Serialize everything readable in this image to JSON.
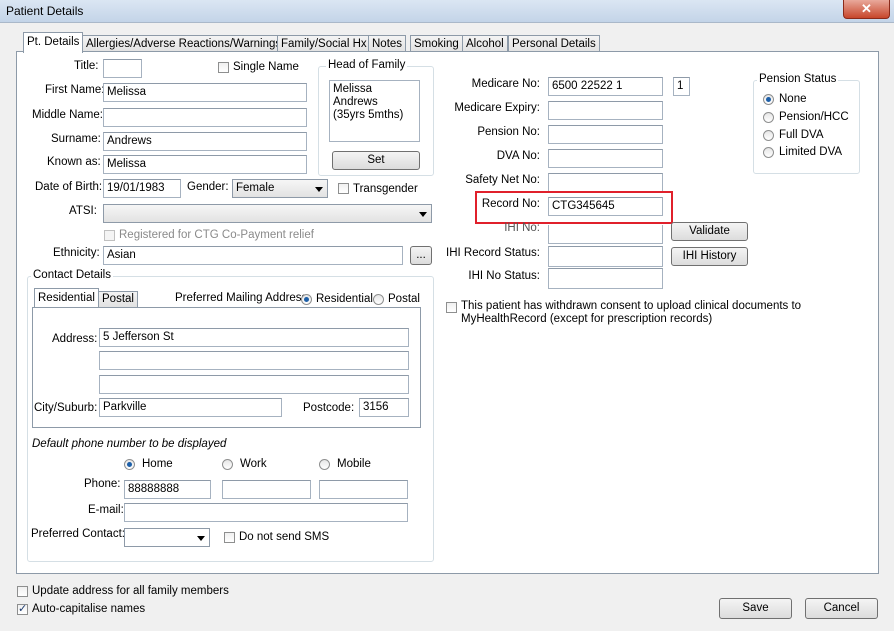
{
  "window": {
    "title": "Patient Details",
    "close_glyph": "✕"
  },
  "tabs": [
    {
      "label": "Pt. Details",
      "active": true
    },
    {
      "label": "Allergies/Adverse Reactions/Warnings"
    },
    {
      "label": "Family/Social Hx"
    },
    {
      "label": "Notes"
    },
    {
      "label": "Smoking"
    },
    {
      "label": "Alcohol"
    },
    {
      "label": "Personal Details"
    }
  ],
  "personal": {
    "title_label": "Title:",
    "title_value": "",
    "single_name_label": "Single Name",
    "first_name_label": "First Name:",
    "first_name": "Melissa",
    "middle_name_label": "Middle Name:",
    "middle_name": "",
    "surname_label": "Surname:",
    "surname": "Andrews",
    "known_as_label": "Known as:",
    "known_as": "Melissa",
    "dob_label": "Date of Birth:",
    "dob": "19/01/1983",
    "gender_label": "Gender:",
    "gender": "Female",
    "transgender_label": "Transgender",
    "atsi_label": "ATSI:",
    "atsi": "",
    "ctg_label": "Registered for CTG Co-Payment relief",
    "ethnicity_label": "Ethnicity:",
    "ethnicity": "Asian",
    "ethnicity_button": "..."
  },
  "head_of_family": {
    "group_label": "Head of Family",
    "value": "Melissa Andrews\n(35yrs 5mths)",
    "set_button": "Set"
  },
  "ids": {
    "medicare_label": "Medicare No:",
    "medicare": "6500 22522 1",
    "medicare_irn": "1",
    "medicare_expiry_label": "Medicare Expiry:",
    "medicare_expiry": "",
    "pension_label": "Pension No:",
    "pension": "",
    "dva_label": "DVA No:",
    "dva": "",
    "safety_net_label": "Safety Net No:",
    "safety_net": "",
    "record_label": "Record No:",
    "record": "CTG345645",
    "ihi_label": "IHI No:",
    "ihi": "",
    "validate_button": "Validate",
    "ihi_record_status_label": "IHI Record Status:",
    "ihi_record_status": "",
    "ihi_history_button": "IHI History",
    "ihi_no_status_label": "IHI No Status:",
    "ihi_no_status": "",
    "consent_label": "This patient has withdrawn consent to upload clinical documents to\nMyHealthRecord (except for prescription records)"
  },
  "pension_status": {
    "group_label": "Pension Status",
    "options": [
      "None",
      "Pension/HCC",
      "Full DVA",
      "Limited DVA"
    ],
    "selected": "None"
  },
  "contact": {
    "group_label": "Contact Details",
    "tabs": [
      "Residential",
      "Postal"
    ],
    "preferred_mailing_label": "Preferred Mailing Address",
    "mailing_options": [
      "Residential",
      "Postal"
    ],
    "address_label": "Address:",
    "address_lines": [
      "5 Jefferson St",
      "",
      ""
    ],
    "city_label": "City/Suburb:",
    "city": "Parkville",
    "postcode_label": "Postcode:",
    "postcode": "3156",
    "default_phone_label": "Default phone number to be displayed",
    "phone_options": [
      "Home",
      "Work",
      "Mobile"
    ],
    "phone_selected": "Home",
    "phone_label": "Phone:",
    "phone_home": "88888888",
    "phone_work": "",
    "phone_mobile": "",
    "email_label": "E-mail:",
    "email": "",
    "preferred_contact_label": "Preferred Contact:",
    "preferred_contact": "",
    "no_sms_label": "Do not send SMS"
  },
  "footer": {
    "update_address_label": "Update address for all family members",
    "auto_cap_label": "Auto-capitalise names",
    "save_button": "Save",
    "cancel_button": "Cancel"
  },
  "colors": {
    "highlight": "#e0202b",
    "radio_dot": "#1d5fa8"
  }
}
